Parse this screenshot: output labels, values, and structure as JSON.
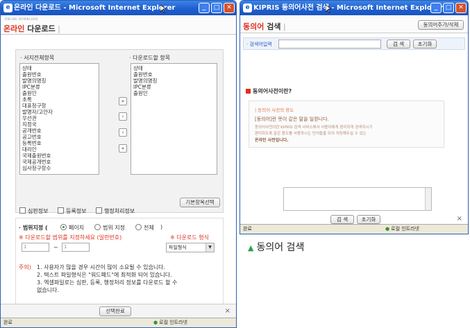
{
  "win1": {
    "title": "온라인 다운로드 - Microsoft Internet Explorer",
    "brand_small": "ONLINE DOWNLOAD",
    "header_red": "온라인",
    "header_dark": " 다운로드",
    "header_bar": " |",
    "left_list_label": "· 서지전체항목",
    "right_list_label": "· 다운로드할 항목",
    "left_items": [
      "상태",
      "출원번호",
      "발명의명칭",
      "IPC분류",
      "출원인",
      "초록",
      "대표청구항",
      "발명자/고안자",
      "우선권",
      "지정국",
      "공개번호",
      "공고번호",
      "등록번호",
      "대리인",
      "국제출원번호",
      "국제공개번호",
      "심사청구항수"
    ],
    "right_items": [
      "상태",
      "출원번호",
      "발명의명칭",
      "IPC분류",
      "출원인"
    ],
    "move_buttons": [
      "»",
      "›",
      "‹",
      "«"
    ],
    "basic_items_button": "기본항목선택",
    "checkboxes": [
      "심판정보",
      "등록정보",
      "행정처리정보"
    ],
    "range_label": "· 범위지정 (",
    "range_options": [
      "페이지",
      "범위 지정",
      "전체"
    ],
    "range_close": ")",
    "range_note": "※ 다운로드할 범위를 지정하세요 (일련번호)",
    "format_note": "※ 다운로드 형식",
    "range_from": "1",
    "range_sep": "~",
    "range_to": "1",
    "format_value": "파일형식",
    "notes_label": "주의)",
    "notes": [
      "1. 사용자가 많을 경우 시간이 많이 소요될 수 있습니다.",
      "2. 텍스트 파일형식은 \"워드패드\"에 최적화 되어 있습니다.",
      "3. 엑셀파일로는 심판, 등록, 행정처리 정보를 다운로드 할 수",
      "    없습니다."
    ],
    "complete_button": "선택완료",
    "close_x": "×",
    "status_left": "완료",
    "status_right": "로컬 인트라넷"
  },
  "win2": {
    "title": "KIPRIS 동의어사전 검색 - Microsoft Internet Explorer",
    "header_red": "동의어",
    "header_dark": " 검색",
    "header_bar": " |",
    "top_button": "동의어추가/삭제",
    "search_label": "· 검색어입력",
    "search_button": "검 색",
    "reset_button": "초기화",
    "section_title": "동의어사전이란?",
    "box_heading": "| 동의어 사전의 용도",
    "box_line1": "[동의어]란 뜻이 같은 말을 일컫니다.",
    "box_line2": "동의어사전이란 KIPRIS 검색 서비스에서 사용자에게 편리하게 검색하시기",
    "box_line3": "편리하도록 같은 용도를 사용하시는 단어들을 모아 저장해두실 수 있는",
    "box_line4": "온라인 사전입니다.",
    "bottom_search": "검 색",
    "bottom_reset": "초기화",
    "close_x": "×",
    "status_left": "완료",
    "status_right": "로컬 인트라넷"
  },
  "caption": "동의어 검색"
}
